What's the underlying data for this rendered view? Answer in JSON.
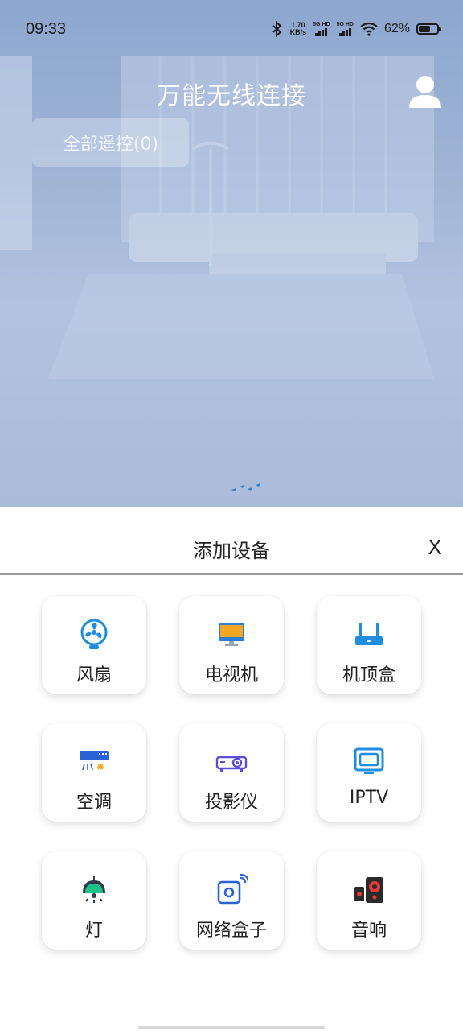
{
  "status_bar": {
    "time": "09:33",
    "net_speed_value": "1.70",
    "net_speed_unit": "KB/s",
    "sim1_label": "5G HD",
    "sim2_label": "5G HD",
    "battery_percent": "62%",
    "battery_level": 0.62
  },
  "header": {
    "title": "万能无线连接",
    "all_remote_button": "全部遥控(0)"
  },
  "sheet": {
    "title": "添加设备",
    "close_label": "X",
    "devices": [
      {
        "label": "风扇",
        "icon": "fan-icon"
      },
      {
        "label": "电视机",
        "icon": "tv-icon"
      },
      {
        "label": "机顶盒",
        "icon": "set-top-box-icon"
      },
      {
        "label": "空调",
        "icon": "air-conditioner-icon"
      },
      {
        "label": "投影仪",
        "icon": "projector-icon"
      },
      {
        "label": "IPTV",
        "icon": "iptv-icon"
      },
      {
        "label": "灯",
        "icon": "lamp-icon"
      },
      {
        "label": "网络盒子",
        "icon": "network-box-icon"
      },
      {
        "label": "音响",
        "icon": "speaker-icon"
      }
    ]
  },
  "colors": {
    "accent_blue": "#1f8ee0",
    "sheet_background": "#ffffff",
    "hero_background": "#9fb4d6"
  }
}
